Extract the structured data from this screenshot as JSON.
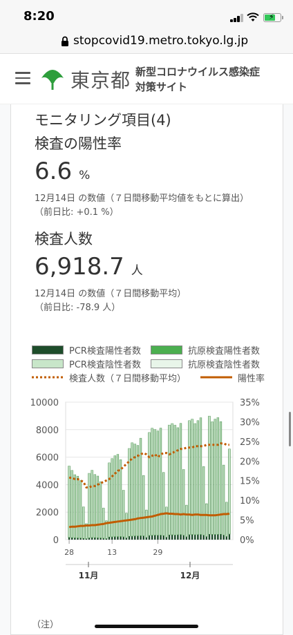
{
  "status_bar": {
    "time": "8:20"
  },
  "browser": {
    "url": "stopcovid19.metro.tokyo.lg.jp"
  },
  "header": {
    "logo_text": "東京都",
    "site_title_line1": "新型コロナウイルス感染症",
    "site_title_line2": "対策サイト"
  },
  "card": {
    "title": "モニタリング項目(4)",
    "positive_rate": {
      "heading": "検査の陽性率",
      "value": "6.6",
      "unit": "%",
      "date_note": "12月14日 の数値（７日間移動平均値をもとに算出）",
      "diff_note": "（前日比: +0.1 %）"
    },
    "test_count": {
      "heading": "検査人数",
      "value": "6,918.7",
      "unit": "人",
      "date_note": "12月14日 の数値（７日間移動平均）",
      "diff_note": "（前日比: -78.9 人）"
    }
  },
  "legend": [
    {
      "label": "PCR検査陽性者数",
      "color": "#1e4d2b",
      "kind": "box"
    },
    {
      "label": "抗原検査陽性者数",
      "color": "#4caf50",
      "kind": "box"
    },
    {
      "label": "PCR検査陰性者数",
      "color": "#c8e6c9",
      "kind": "box"
    },
    {
      "label": "抗原検査陰性者数",
      "color": "#e8f5e9",
      "kind": "box"
    },
    {
      "label": "検査人数（７日間移動平均）",
      "color": "#c15c00",
      "kind": "dotted"
    },
    {
      "label": "陽性率",
      "color": "#c15c00",
      "kind": "line"
    }
  ],
  "footnote": "（注）",
  "chart_data": {
    "type": "bar",
    "y_left": {
      "ticks": [
        "0",
        "2000",
        "4000",
        "6000",
        "8000",
        "10000"
      ],
      "range": [
        0,
        10000
      ]
    },
    "y_right": {
      "ticks": [
        "0%",
        "5%",
        "10%",
        "15%",
        "20%",
        "25%",
        "30%",
        "35%"
      ],
      "range": [
        0,
        35
      ]
    },
    "x_ticks": [
      "28",
      "13",
      "29"
    ],
    "x_months": [
      "11月",
      "12月"
    ],
    "series": [
      {
        "name": "PCR検査陽性者数",
        "values": [
          150,
          130,
          120,
          110,
          100,
          80,
          60,
          120,
          140,
          130,
          120,
          110,
          90,
          70,
          180,
          190,
          200,
          200,
          210,
          190,
          120,
          230,
          240,
          250,
          250,
          270,
          260,
          150,
          290,
          300,
          310,
          300,
          310,
          280,
          170,
          330,
          340,
          320,
          340,
          350,
          300,
          200,
          350,
          360,
          340,
          350,
          360,
          310,
          210,
          380,
          370,
          360,
          370,
          380,
          320,
          220,
          390
        ]
      },
      {
        "name": "抗原検査陽性者数",
        "values": [
          10,
          10,
          10,
          10,
          10,
          10,
          5,
          10,
          10,
          10,
          10,
          10,
          10,
          5,
          10,
          10,
          10,
          10,
          10,
          10,
          5,
          10,
          10,
          10,
          10,
          10,
          10,
          5,
          10,
          10,
          10,
          10,
          10,
          10,
          5,
          10,
          10,
          10,
          10,
          10,
          10,
          5,
          10,
          10,
          10,
          10,
          10,
          10,
          5,
          10,
          10,
          10,
          10,
          10,
          10,
          5,
          10
        ]
      },
      {
        "name": "PCR検査陰性者数",
        "values": [
          5200,
          4900,
          4600,
          4500,
          4200,
          2300,
          1100,
          4700,
          4900,
          4600,
          4500,
          4100,
          2200,
          1300,
          5400,
          5700,
          5900,
          6000,
          5600,
          3400,
          1800,
          6400,
          6800,
          6700,
          6600,
          7100,
          4400,
          2000,
          7500,
          7800,
          7700,
          7600,
          7800,
          4600,
          2200,
          8000,
          8100,
          8000,
          7800,
          8100,
          4800,
          2300,
          8300,
          8400,
          8100,
          8300,
          8500,
          5000,
          2400,
          8600,
          8200,
          8400,
          8500,
          8200,
          5100,
          2500,
          6200
        ]
      },
      {
        "name": "抗原検査陰性者数",
        "values": [
          30,
          30,
          30,
          30,
          30,
          20,
          10,
          30,
          30,
          30,
          30,
          30,
          20,
          10,
          30,
          30,
          30,
          30,
          30,
          20,
          10,
          30,
          30,
          30,
          30,
          30,
          20,
          10,
          30,
          30,
          30,
          30,
          30,
          20,
          10,
          30,
          30,
          30,
          30,
          30,
          20,
          10,
          30,
          30,
          30,
          30,
          30,
          20,
          10,
          30,
          30,
          30,
          30,
          30,
          20,
          10,
          30
        ]
      },
      {
        "name": "検査人数（７日間移動平均）",
        "values": [
          4500,
          4500,
          4400,
          4400,
          4300,
          4200,
          3800,
          3800,
          3900,
          3900,
          4000,
          4100,
          4200,
          4300,
          4400,
          4600,
          4800,
          5000,
          5100,
          5300,
          5500,
          5700,
          5900,
          6000,
          6100,
          6200,
          6300,
          6200,
          6000,
          6100,
          6200,
          6000,
          6200,
          6300,
          6300,
          6200,
          6300,
          6400,
          6500,
          6600,
          6600,
          6700,
          6700,
          6700,
          6800,
          6800,
          6800,
          6800,
          6900,
          6900,
          6900,
          6900,
          6900,
          7000,
          7000,
          6900,
          6900
        ]
      },
      {
        "name": "陽性率",
        "values": [
          3.2,
          3.3,
          3.3,
          3.4,
          3.5,
          3.5,
          3.6,
          3.6,
          3.7,
          3.7,
          3.8,
          3.9,
          4.0,
          4.2,
          4.3,
          4.4,
          4.5,
          4.6,
          4.7,
          4.8,
          4.9,
          5.0,
          5.1,
          5.2,
          5.4,
          5.5,
          5.6,
          5.7,
          5.8,
          5.9,
          6.1,
          6.3,
          6.5,
          6.6,
          6.7,
          6.6,
          6.6,
          6.5,
          6.5,
          6.4,
          6.5,
          6.4,
          6.4,
          6.3,
          6.4,
          6.4,
          6.3,
          6.3,
          6.3,
          6.2,
          6.2,
          6.2,
          6.3,
          6.4,
          6.5,
          6.5,
          6.6
        ]
      }
    ]
  }
}
